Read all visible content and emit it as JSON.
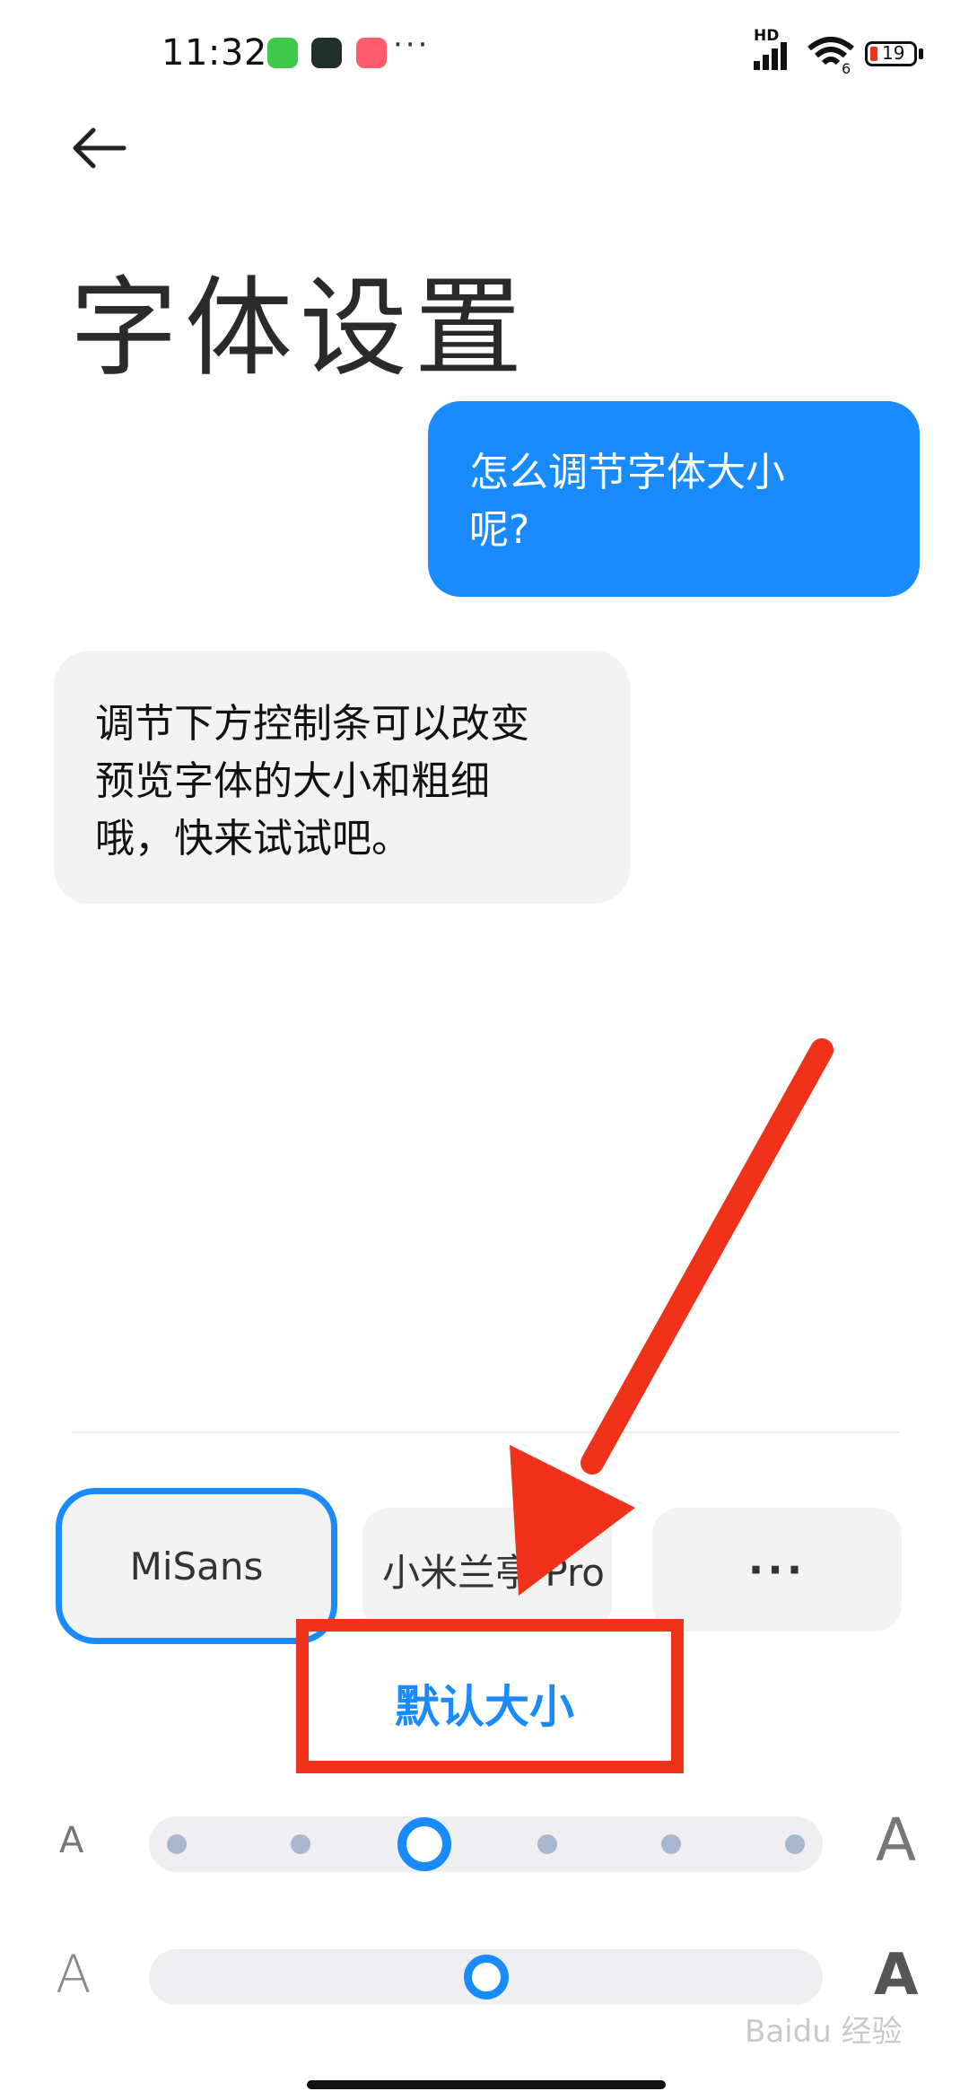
{
  "status_bar": {
    "time": "11:32",
    "network": "HD",
    "battery": "19",
    "more": "···"
  },
  "header": {
    "title": "字体设置"
  },
  "chat": {
    "user_line1": "怎么调节字体大小",
    "user_line2": "呢?",
    "bot_line1": "调节下方控制条可以改变",
    "bot_line2": "预览字体的大小和粗细",
    "bot_line3": "哦，快来试试吧。"
  },
  "fonts": {
    "options": [
      "MiSans",
      "小米兰亭 Pro"
    ],
    "selected": "MiSans",
    "more_label": "···"
  },
  "default_size_label": "默认大小",
  "size_slider": {
    "min_label": "A",
    "max_label": "A",
    "steps": 6,
    "selected_index": 2
  },
  "weight_slider": {
    "min_label": "A",
    "max_label": "A",
    "value_fraction": 0.5
  },
  "watermark": "Baidu 经验",
  "colors": {
    "accent": "#1a8bff",
    "annotation_red": "#f0321a"
  }
}
